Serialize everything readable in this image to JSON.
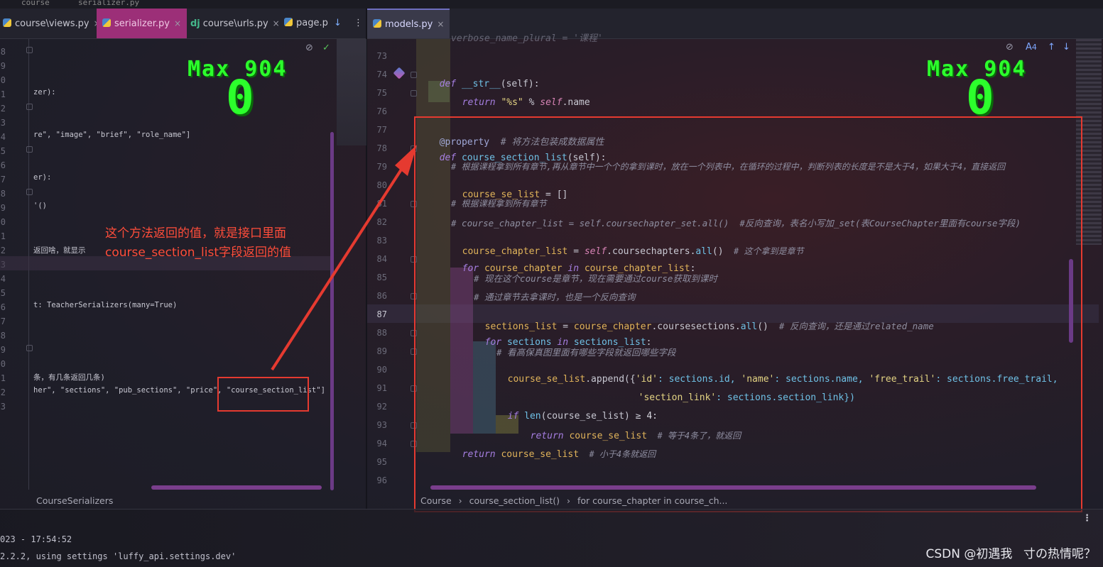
{
  "top_strip": {
    "left": "course",
    "right": "serializer.py"
  },
  "tabs": [
    {
      "label": "course\\views.py",
      "icon": "python-icon",
      "closable": true
    },
    {
      "label": "serializer.py",
      "icon": "python-icon",
      "closable": true,
      "state": "active-left"
    },
    {
      "label": "course\\urls.py",
      "icon": "django-icon",
      "closable": true
    },
    {
      "label": "page.p",
      "icon": "python-icon",
      "closable": false
    },
    {
      "label": "models.py",
      "icon": "python-icon",
      "closable": true,
      "state": "active-right"
    }
  ],
  "tab_extras": {
    "download_glyph": "↓",
    "more_glyph": "⋮",
    "close_glyph": "×"
  },
  "counter": {
    "max_label": "Max 904",
    "value": "0"
  },
  "left_pane": {
    "gutter": [
      "8",
      "9",
      "10",
      "11",
      "12",
      "13",
      "14",
      "15",
      "16",
      "17",
      "18",
      "19",
      "20",
      "21",
      "22",
      "23",
      "24",
      "25",
      "26",
      "27",
      "28",
      "29",
      "30",
      "31",
      "32",
      "33"
    ],
    "code_lines": [
      {
        "text": "zer):",
        "kind": "s"
      },
      {
        "text": "re\", \"image\", \"brief\", \"role_name\"]",
        "kind": "s"
      },
      {
        "text": "er):",
        "kind": "s"
      },
      {
        "text": "'()",
        "kind": "s"
      },
      {
        "text": "返回啥，就显示",
        "kind": "cm"
      },
      {
        "text": "t: TeacherSerializers(many=True)",
        "kind": "cm"
      },
      {
        "text": "条，有几条返回几条)",
        "kind": "cm"
      },
      {
        "text": "her\", \"sections\", \"pub_sections\", \"price\", \"course_section_list\"]",
        "kind": "s"
      }
    ],
    "breadcrumb": "CourseSerializers"
  },
  "annotation": {
    "line1": "这个方法返回的值，就是接口里面",
    "line2": "course_section_list字段返回的值",
    "color": "#ff4d3a"
  },
  "right_pane": {
    "line_numbers": [
      "73",
      "74",
      "75",
      "76",
      "77",
      "78",
      "79",
      "80",
      "81",
      "82",
      "83",
      "84",
      "85",
      "86",
      "87",
      "88",
      "89",
      "90",
      "91",
      "92",
      "93",
      "94",
      "95",
      "96"
    ],
    "top_partial": "verbose_name_plural = '课程'",
    "lines": {
      "l74": {
        "kw": "def",
        "name": "__str__",
        "args": "(self):"
      },
      "l75": {
        "kw": "return",
        "str": "\"%s\"",
        "op": " % ",
        "self": "self",
        "attr": ".name"
      },
      "l77": {
        "dec": "@property",
        "cmt": "  # 将方法包装成数据属性"
      },
      "l78": {
        "kw": "def",
        "name": "course_section_list",
        "args": "(self):"
      },
      "l79": {
        "cmt": "# 根据课程拿到所有章节,再从章节中一个个的拿到课时，放在一个列表中，在循环的过程中，判断列表的长度是不是大于4，如果大于4，直接返回"
      },
      "l80": {
        "var": "course_se_list",
        "rest": " = []"
      },
      "l81": {
        "cmt": "# 根据课程拿到所有章节"
      },
      "l82": {
        "cmt": "# course_chapter_list = self.coursechapter_set.all()  #反向查询，表名小写加_set(表CourseChapter里面有course字段)"
      },
      "l83": {
        "var": "course_chapter_list",
        "op": " = ",
        "self": "self",
        "attr": ".coursechapters.",
        "fn": "all",
        "call": "()",
        "cmt": "  # 这个拿到是章节"
      },
      "l84": {
        "kw": "for",
        "v1": " course_chapter ",
        "kw2": "in",
        "v2": " course_chapter_list",
        "rest": ":"
      },
      "l85": {
        "cmt": "# 现在这个course是章节，现在需要通过course获取到课时"
      },
      "l86": {
        "cmt": "# 通过章节去拿课时，也是一个反向查询"
      },
      "l87": {
        "var": "sections_list",
        "op": " = ",
        "v2": "course_chapter",
        "attr": ".coursesections.",
        "fn": "all",
        "call": "()",
        "cmt": "  # 反向查询，还是通过related_name"
      },
      "l88": {
        "kw": "for",
        "v1": " sections ",
        "kw2": "in",
        "v2": " sections_list",
        "rest": ":"
      },
      "l89": {
        "cmt": "# 看高保真图里面有哪些字段就返回哪些字段"
      },
      "l90": {
        "var": "course_se_list",
        "attr": ".append({",
        "s1": "'id'",
        "p1": ": sections.id, ",
        "s2": "'name'",
        "p2": ": sections.name, ",
        "s3": "'free_trail'",
        "p3": ": sections.free_trail,"
      },
      "l91": {
        "s1": "'section_link'",
        "p1": ": sections.section_link})"
      },
      "l92": {
        "kw": "if",
        "fn": " len",
        "p1": "(course_se_list) ",
        "op": "≥",
        "num": " 4",
        "rest": ":"
      },
      "l93": {
        "kw": "return",
        "var": " course_se_list",
        "cmt": "  # 等于4条了，就返回"
      },
      "l94": {
        "kw": "return",
        "var": " course_se_list",
        "cmt": "  # 小于4条就返回"
      }
    },
    "breadcrumb": [
      "Course",
      "course_section_list()",
      "for course_chapter in course_ch..."
    ],
    "breadcrumb_sep": "›",
    "hints": {
      "count": "4",
      "hide_glyph": "⊘",
      "check_glyph": "✓",
      "up_glyph": "↑",
      "down_glyph": "↓",
      "hint_glyph": "A"
    }
  },
  "console": {
    "line1": "023 - 17:54:52",
    "line2": "2.2.2, using settings 'luffy_api.settings.dev'"
  },
  "watermark": "CSDN @初遇我ㅤ寸の热情呢？"
}
